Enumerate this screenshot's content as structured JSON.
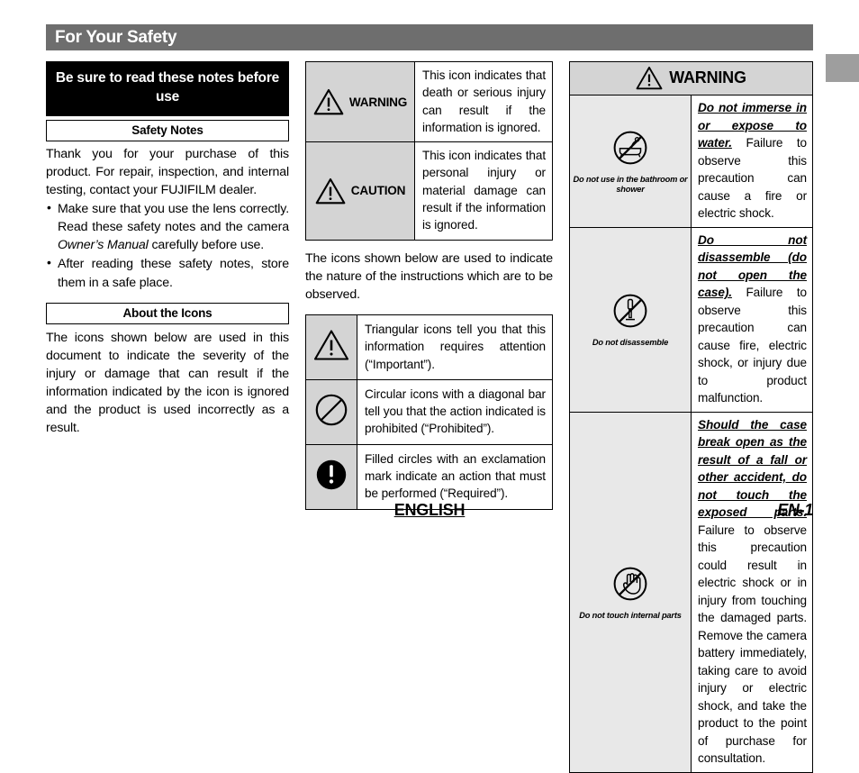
{
  "header": {
    "title": "For Your Safety"
  },
  "edge_tab": {
    "color": "#9e9e9e"
  },
  "left_column": {
    "banner": "Be sure to read these notes before use",
    "safety_notes_head": "Safety Notes",
    "intro_paragraph": "Thank you for your purchase of this product. For repair, inspection, and internal testing, contact your FUJIFILM dealer.",
    "bullets": [
      {
        "text_before": "Make sure that you use the lens correctly. Read these safety notes and the camera ",
        "italic": "Owner’s Manual",
        "text_after": " carefully before use."
      },
      {
        "text_before": "After reading these safety notes, store them in a safe place.",
        "italic": "",
        "text_after": ""
      }
    ],
    "about_icons_head": "About the Icons",
    "about_icons_paragraph": "The icons shown below are used in this document to indicate the severity of the injury or damage that can result if the information indicated by the icon is ignored and the product is used incorrectly as a result."
  },
  "middle_column": {
    "severity_rows": [
      {
        "icon": "warning-triangle-icon",
        "label": "WARNING",
        "description": "This icon indicates that death or serious injury can result if the information is ignored."
      },
      {
        "icon": "warning-triangle-icon",
        "label": "CAUTION",
        "description": "This icon indicates that personal injury or material damage can result if the information is ignored."
      }
    ],
    "intro_paragraph": "The icons shown below are used to indicate the nature of the instructions which are to be observed.",
    "instruction_rows": [
      {
        "icon": "warning-triangle-icon",
        "description": "Triangular icons tell you that this information requires attention (“Important”)."
      },
      {
        "icon": "prohibited-circle-slash-icon",
        "description": "Circular icons with a diagonal bar tell you that the action indicated is prohibited (“Prohibited”)."
      },
      {
        "icon": "required-filled-exclamation-icon",
        "description": "Filled circles with an exclamation mark indicate an action that must be performed (“Required”)."
      }
    ]
  },
  "right_column": {
    "warning_header": {
      "icon": "warning-triangle-icon",
      "label": "WARNING"
    },
    "warning_rows": [
      {
        "icon": "no-bathtub-icon",
        "caption": "Do not use in the bathroom or shower",
        "lead_in": "Do not immerse in or expose to water.",
        "body": " Failure to observe this precaution can cause a fire or electric shock."
      },
      {
        "icon": "no-disassemble-screwdriver-icon",
        "caption": "Do not disassemble",
        "lead_in": "Do not disassemble (do not open the case).",
        "body": " Failure to observe this precaution can cause fire, electric shock, or injury due to product malfunction."
      },
      {
        "icon": "no-touch-hand-icon",
        "caption": "Do not touch internal parts",
        "lead_in": "Should the case break open as the result of a fall or other accident, do not touch the exposed parts.",
        "body": " Failure to observe this precaution could result in electric shock or in injury from touching the damaged parts. Remove the camera battery immediately, taking care to avoid injury or electric shock, and take the product to the point of purchase for consultation."
      }
    ]
  },
  "footer": {
    "language": "ENGLISH",
    "page_number": "EN-1"
  },
  "colors": {
    "header_bar": "#6e6e6e",
    "banner_bg": "#000000",
    "icon_cell_bg": "#d4d4d4",
    "warn_icon_cell_bg": "#e8e8e8"
  }
}
